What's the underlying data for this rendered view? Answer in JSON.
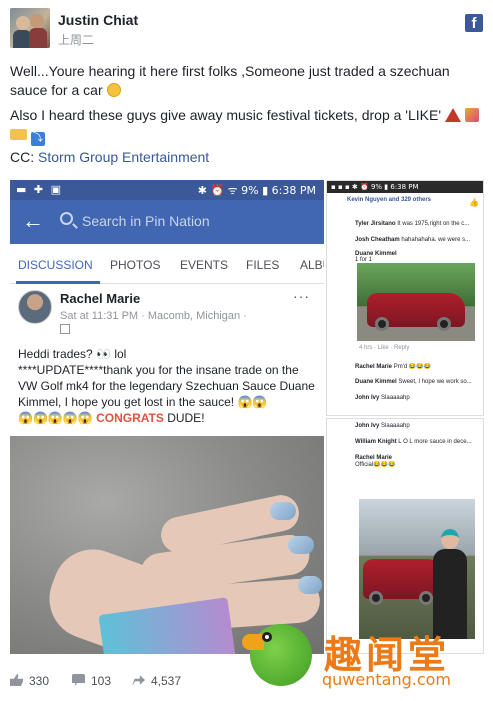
{
  "post": {
    "author": "Justin Chiat",
    "time": "上周二",
    "fb_icon": "f",
    "line1": "Well...Youre hearing it here first folks ,Someone just traded a szechuan sauce for a car",
    "line2": "Also I heard these guys give away music festival tickets, drop a 'LIKE'",
    "cc_label": "CC:",
    "cc_link": "Storm Group Entertainment"
  },
  "phone": {
    "status_left": "▬ ✚ ▣",
    "status_right": "✱ ⏰ ᯤ 9% ▮ 6:38 PM",
    "search_placeholder": "Search in Pin Nation",
    "tabs": [
      "DISCUSSION",
      "PHOTOS",
      "EVENTS",
      "FILES",
      "ALBU"
    ],
    "post_author": "Rachel Marie",
    "post_meta": "Sat at 11:31 PM · Macomb, Michigan ·",
    "post_body_1": "Heddi trades? 👀 lol",
    "post_body_2": "****UPDATE****thank you for the insane trade on the VW Golf mk4 for the legendary Szechuan Sauce Duane Kimmel, I hope you get lost in the sauce! 😱😱",
    "post_body_3": "😱😱😱😱😱",
    "congrats": "CONGRATS",
    "post_body_4": "DUDE!",
    "dots": "···"
  },
  "shot2": {
    "status": "▪ ▪ ▪          ✱ ⏰ 9% ▮ 6:38 PM",
    "reactors": "Kevin Nguyen and 329 others",
    "c1_name": "Tyler Jirsitano",
    "c1_text": "It was 1975,right on the c...",
    "c2_name": "Josh Cheatham",
    "c2_text": "hahahahaha. we were s...",
    "c3_name": "Duane Kimmel",
    "c3_text": "1 for 1",
    "c3_actions": "4 hrs · Like · Reply",
    "c4_name": "Rachel Marie",
    "c4_text": "Pm'd 😂😂😂",
    "c5_name": "Duane Kimmel",
    "c5_text": "Sweet, I hope we work so...",
    "c6_name": "John Ivy",
    "c6_text": "Slaaaaahp"
  },
  "shot3": {
    "c1_name": "John Ivy",
    "c1_text": "Slaaaaahp",
    "c2_name": "William Knight",
    "c2_text": "L O L more sauce in dece...",
    "c3_name": "Rachel Marie",
    "c3_text": "Official😂😂😂"
  },
  "footer": {
    "likes": "330",
    "comments": "103",
    "shares": "4,537"
  },
  "watermark": {
    "cn": "趣闻堂",
    "url": "quwentang.com"
  },
  "colors": {
    "facebook_blue": "#3b5998",
    "link": "#365899",
    "congrats": "#e0533e",
    "watermark": "#ec7a16"
  }
}
